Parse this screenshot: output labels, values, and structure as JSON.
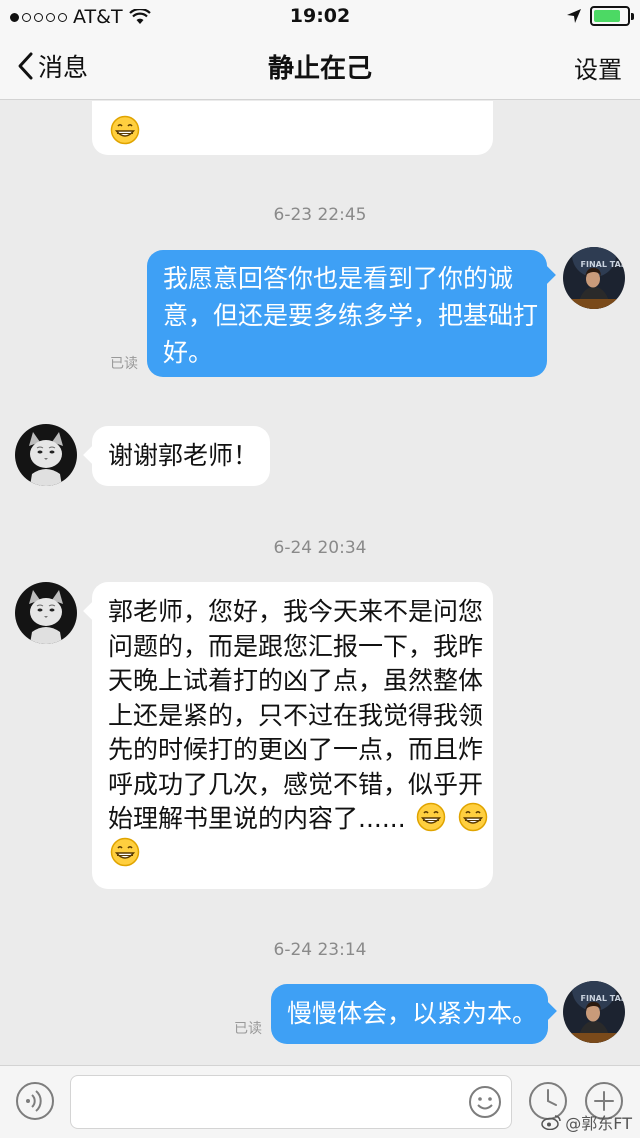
{
  "status_bar": {
    "carrier": "AT&T",
    "time": "19:02",
    "signal_bars": 1,
    "signal_total": 5
  },
  "nav": {
    "back_label": "消息",
    "title": "静止在己",
    "settings_label": "设置"
  },
  "messages": [
    {
      "type": "timestamp",
      "text": "6-23 22:45"
    },
    {
      "type": "outgoing",
      "text": "我愿意回答你也是看到了你的诚意，但还是要多练多学，把基础打好。",
      "lines": [
        "我愿意回答你也是看到了你的诚",
        "意，但还是要多练多学，把基础打",
        "好。"
      ],
      "receipt": "已读"
    },
    {
      "type": "incoming",
      "text": "谢谢郭老师！"
    },
    {
      "type": "timestamp",
      "text": "6-24 20:34"
    },
    {
      "type": "incoming",
      "text": "郭老师，您好，我今天来不是问您问题的，而是跟您汇报一下，我昨天晚上试着打的凶了点，虽然整体上还是紧的，只不过在我觉得我领先的时候打的更凶了一点，而且炸呼成功了几次，感觉不错，似乎开始理解书里说的内容了......",
      "lines": [
        "郭老师，您好，我今天来不是问您",
        "问题的，而是跟您汇报一下，我昨",
        "天晚上试着打的凶了点，虽然整体",
        "上还是紧的，只不过在我觉得我领",
        "先的时候打的更凶了一点，而且炸",
        "呼成功了几次，感觉不错，似乎开",
        "始理解书里说的内容了......"
      ]
    },
    {
      "type": "timestamp",
      "text": "6-24 23:14"
    },
    {
      "type": "outgoing",
      "text": "慢慢体会，以紧为本。",
      "receipt": "已读"
    }
  ],
  "avatars": {
    "self_badge": "FINAL TABLE"
  },
  "input": {
    "placeholder": ""
  },
  "watermark": "@郭东FT",
  "colors": {
    "outgoing_bubble": "#3ea0f5",
    "incoming_bubble": "#ffffff",
    "background": "#ebebeb",
    "battery": "#4cd964"
  }
}
